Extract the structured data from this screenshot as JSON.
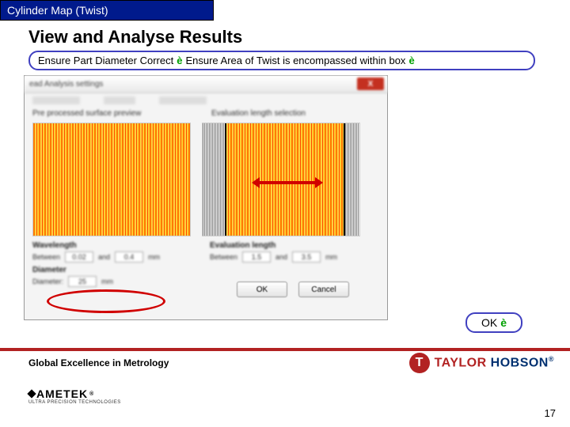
{
  "titleBar": "Cylinder Map (Twist)",
  "heading": "View and Analyse Results",
  "callout": {
    "part1": "Ensure Part Diameter Correct",
    "part2": "Ensure Area of Twist is encompassed within box"
  },
  "dialog": {
    "title": "ead Analysis settings",
    "closeIcon": "X",
    "leftPanelLabel": "Pre processed surface preview",
    "rightPanelLabel": "Evaluation length selection",
    "wavelength": {
      "label": "Wavelength",
      "betweenLabel": "Between",
      "andLabel": "and",
      "unit": "mm",
      "from": "0.02",
      "to": "0.4"
    },
    "evalLength": {
      "label": "Evaluation length",
      "betweenLabel": "Between",
      "andLabel": "and",
      "unit": "mm",
      "from": "1.5",
      "to": "3.5"
    },
    "diameter": {
      "label": "Diameter",
      "fieldLabel": "Diameter:",
      "value": "25",
      "unit": "mm"
    },
    "okBtn": "OK",
    "cancelBtn": "Cancel"
  },
  "okCallout": "OK",
  "footerText": "Global Excellence in Metrology",
  "brand": {
    "circle": "T",
    "part1": "TAYLOR",
    "part2": " HOBSON",
    "reg": "®"
  },
  "ametek": {
    "main": "AMETEK",
    "reg": "®",
    "sub": "ULTRA PRECISION TECHNOLOGIES"
  },
  "pageNumber": "17",
  "arrowGlyph": "è"
}
